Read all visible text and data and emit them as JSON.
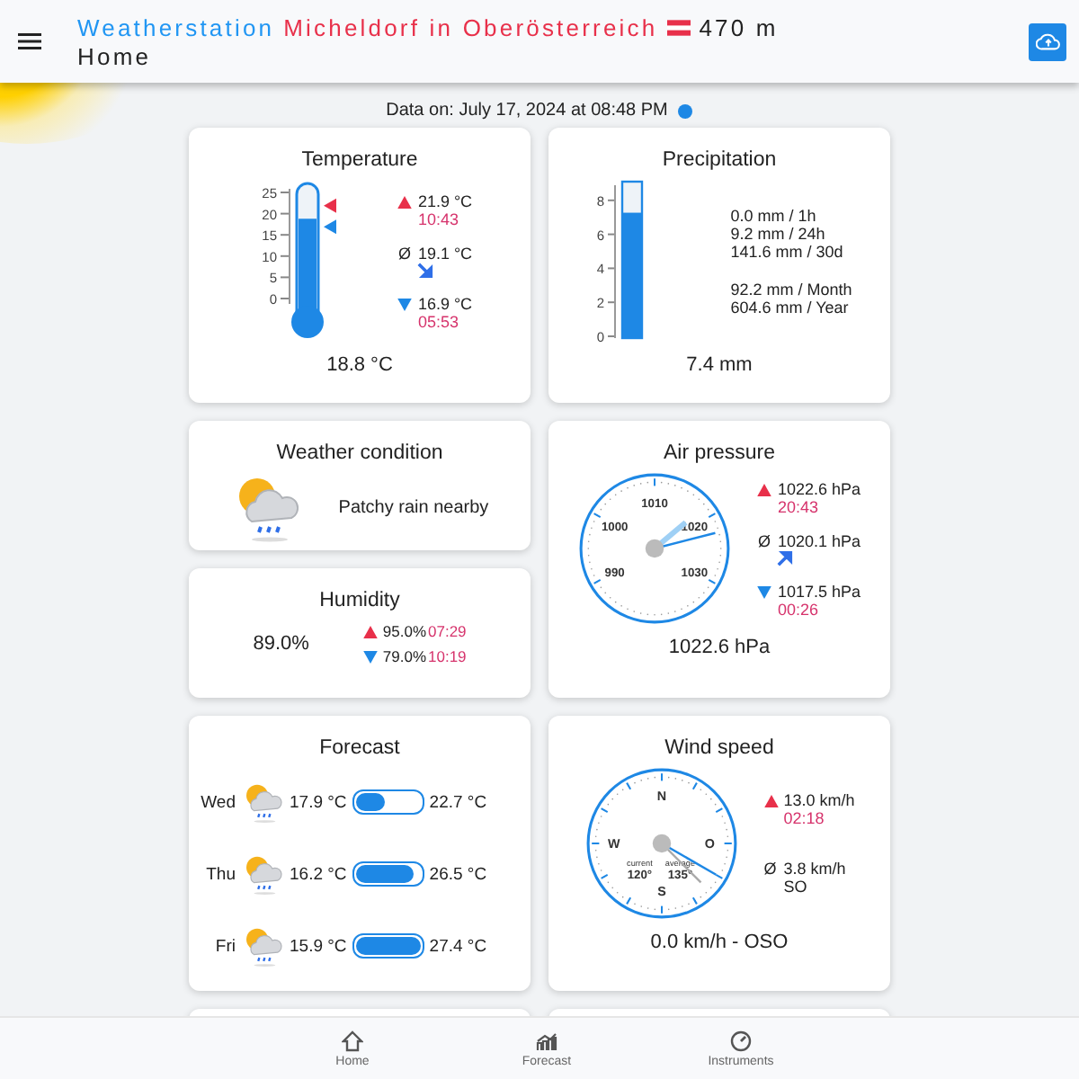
{
  "header": {
    "title_parts": [
      {
        "text": "Weatherstation",
        "kind": "station"
      },
      {
        "text": "Micheldorf in Oberösterreich",
        "kind": "location"
      }
    ],
    "altitude": "470 m",
    "subtitle": "Home"
  },
  "data_time": "Data on: July 17, 2024 at 08:48 PM",
  "temperature": {
    "title": "Temperature",
    "scale": [
      "25",
      "20",
      "15",
      "10",
      "5",
      "0"
    ],
    "level": 0.752,
    "reading": "18.8 °C",
    "stats": [
      {
        "kind": "max",
        "value": "21.9 °C",
        "time": "10:43",
        "level": 0.876
      },
      {
        "kind": "avg",
        "symbol": "Ø",
        "value": "19.1 °C",
        "rising": false
      },
      {
        "kind": "min",
        "value": "16.9 °C",
        "time": "05:53",
        "level": 0.676
      }
    ]
  },
  "precipitation": {
    "title": "Precipitation",
    "scale": [
      "8",
      "6",
      "4",
      "2",
      "0"
    ],
    "level": 0.83,
    "reading": "7.4 mm",
    "lines": [
      "0.0 mm  / 1h",
      "9.2 mm / 24h",
      "141.6 mm / 30d"
    ],
    "lines_2": [
      "92.2 mm  / Month",
      "604.6 mm / Year"
    ]
  },
  "weather_condition": {
    "title": "Weather condition",
    "text": "Patchy rain nearby"
  },
  "air_pressure": {
    "title": "Air pressure",
    "dial_labels": [
      "990",
      "1000",
      "1010",
      "1020",
      "1030"
    ],
    "level": 0.815,
    "reading": "1022.6 hPa",
    "stats": [
      {
        "kind": "max",
        "value": "1022.6 hPa",
        "time": "20:43"
      },
      {
        "kind": "avg",
        "symbol": "Ø",
        "value": "1020.1 hPa",
        "rising": true
      },
      {
        "kind": "min",
        "value": "1017.5 hPa",
        "time": "00:26"
      }
    ]
  },
  "humidity": {
    "title": "Humidity",
    "reading": "89.0%",
    "stats": [
      {
        "kind": "max",
        "value": "95.0%",
        "time": "07:29"
      },
      {
        "kind": "min",
        "value": "79.0%",
        "time": "10:19"
      }
    ]
  },
  "forecast": {
    "title": "Forecast",
    "days": [
      {
        "day": "Wed",
        "min": "17.9 °C",
        "max": "22.7 °C",
        "level": 0.45
      },
      {
        "day": "Thu",
        "min": "16.2 °C",
        "max": "26.5 °C",
        "level": 0.9
      },
      {
        "day": "Fri",
        "min": "15.9 °C",
        "max": "27.4 °C",
        "level": 1
      }
    ]
  },
  "wind_speed": {
    "title": "Wind speed",
    "compass": [
      "N",
      "O",
      "S",
      "W"
    ],
    "current": {
      "label": "current",
      "value": "120°"
    },
    "average": {
      "label": "average",
      "value": "135°"
    },
    "reading": "0.0 km/h - OSO",
    "stats": [
      {
        "kind": "max",
        "value": "13.0 km/h",
        "time": "02:18"
      },
      {
        "kind": "avg",
        "symbol": "Ø",
        "value": "3.8 km/h",
        "time": "SO"
      }
    ]
  },
  "nav": [
    {
      "label": "Home"
    },
    {
      "label": "Forecast"
    },
    {
      "label": "Instruments"
    }
  ]
}
